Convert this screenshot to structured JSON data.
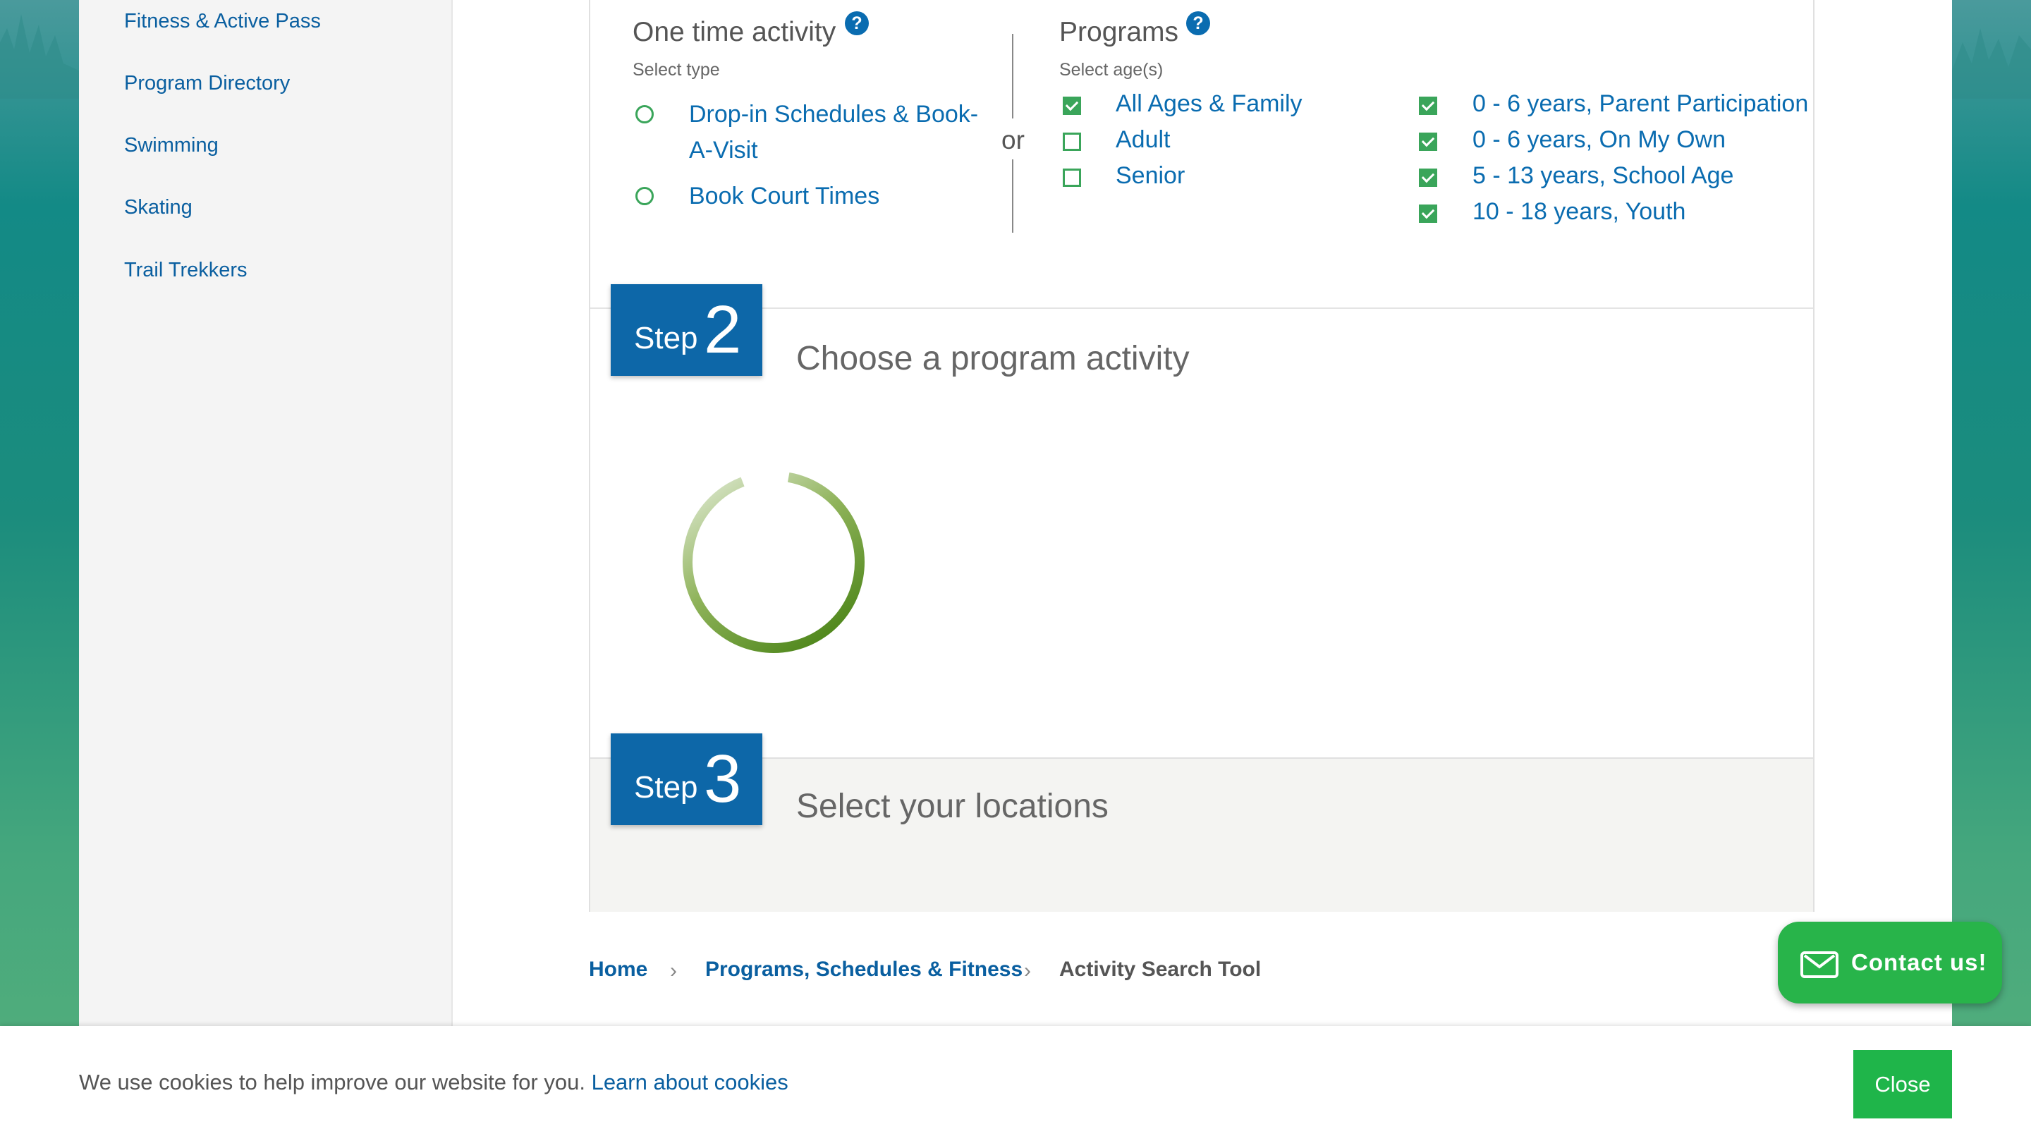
{
  "sidebar": {
    "items": [
      {
        "label": "Fitness & Active Pass"
      },
      {
        "label": "Program Directory"
      },
      {
        "label": "Swimming"
      },
      {
        "label": "Skating"
      },
      {
        "label": "Trail Trekkers"
      }
    ]
  },
  "step1": {
    "one_time": {
      "title": "One time activity",
      "subtitle": "Select type",
      "options": [
        {
          "label": "Drop-in Schedules & Book-A-Visit",
          "selected": false
        },
        {
          "label": "Book Court Times",
          "selected": false
        }
      ]
    },
    "or_label": "or",
    "programs": {
      "title": "Programs",
      "subtitle": "Select age(s)",
      "ages": [
        {
          "label": "All Ages & Family",
          "checked": true
        },
        {
          "label": "Adult",
          "checked": false
        },
        {
          "label": "Senior",
          "checked": false
        },
        {
          "label": "0 - 6 years, Parent Participation",
          "checked": true
        },
        {
          "label": "0 - 6 years, On My Own",
          "checked": true
        },
        {
          "label": "5 - 13 years, School Age",
          "checked": true
        },
        {
          "label": "10 - 18 years, Youth",
          "checked": true
        }
      ]
    }
  },
  "step2": {
    "word": "Step",
    "number": "2",
    "title": "Choose a program activity"
  },
  "step3": {
    "word": "Step",
    "number": "3",
    "title": "Select your locations"
  },
  "breadcrumb": [
    "Home",
    "Programs, Schedules & Fitness",
    "Activity Search Tool"
  ],
  "contact": {
    "label": "Contact us!"
  },
  "cookie": {
    "text": "We use cookies to help improve our website for you.",
    "link": "Learn about cookies",
    "close": "Close"
  },
  "colors": {
    "link_blue": "#0a6cb0",
    "step_badge": "#0d67a8",
    "check_green": "#3aa55a",
    "contact_green": "#28b44a",
    "spinner_green": "#4f8a10"
  }
}
